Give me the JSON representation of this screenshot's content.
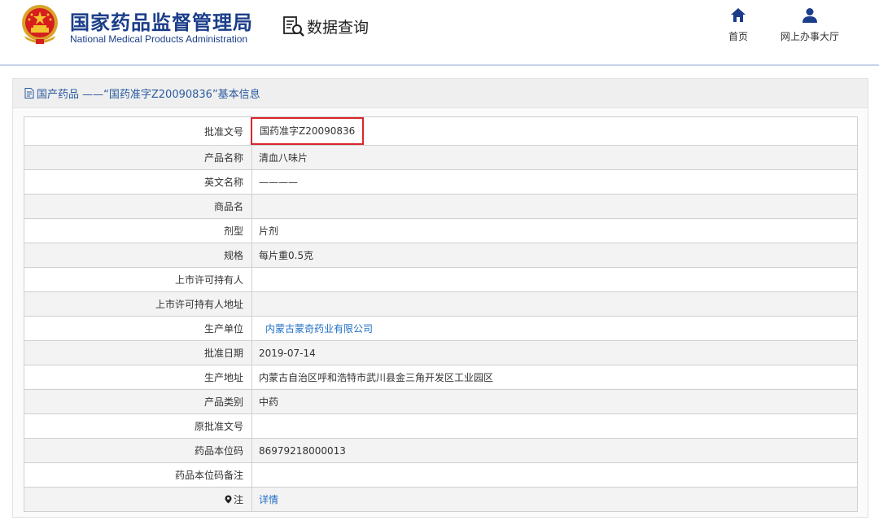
{
  "header": {
    "brand_cn": "国家药品监督管理局",
    "brand_en": "National Medical Products Administration",
    "data_query": "数据查询",
    "nav": [
      {
        "label": "首页",
        "icon": "home-icon"
      },
      {
        "label": "网上办事大厅",
        "icon": "user-icon"
      }
    ],
    "brand_color": "#1b3d8a",
    "emblem_icon": "national-emblem-icon"
  },
  "panel": {
    "title": "国产药品 ——“国药准字Z20090836”基本信息",
    "title_icon": "document-icon"
  },
  "rows": [
    {
      "label": "批准文号",
      "value": "国药准字Z20090836"
    },
    {
      "label": "产品名称",
      "value": "清血八味片"
    },
    {
      "label": "英文名称",
      "value": "————"
    },
    {
      "label": "商品名",
      "value": ""
    },
    {
      "label": "剂型",
      "value": "片剂"
    },
    {
      "label": "规格",
      "value": "每片重0.5克"
    },
    {
      "label": "上市许可持有人",
      "value": ""
    },
    {
      "label": "上市许可持有人地址",
      "value": ""
    },
    {
      "label": "生产单位",
      "value": "内蒙古蒙奇药业有限公司"
    },
    {
      "label": "批准日期",
      "value": "2019-07-14"
    },
    {
      "label": "生产地址",
      "value": "内蒙古自治区呼和浩特市武川县金三角开发区工业园区"
    },
    {
      "label": "产品类别",
      "value": "中药"
    },
    {
      "label": "原批准文号",
      "value": ""
    },
    {
      "label": "药品本位码",
      "value": "86979218000013"
    },
    {
      "label": "药品本位码备注",
      "value": ""
    },
    {
      "label": "注",
      "value": "详情",
      "icon": "pin-icon"
    }
  ],
  "colors": {
    "link": "#1f6fc5",
    "highlight": "#d9262b",
    "title_text": "#2a5aa0"
  }
}
